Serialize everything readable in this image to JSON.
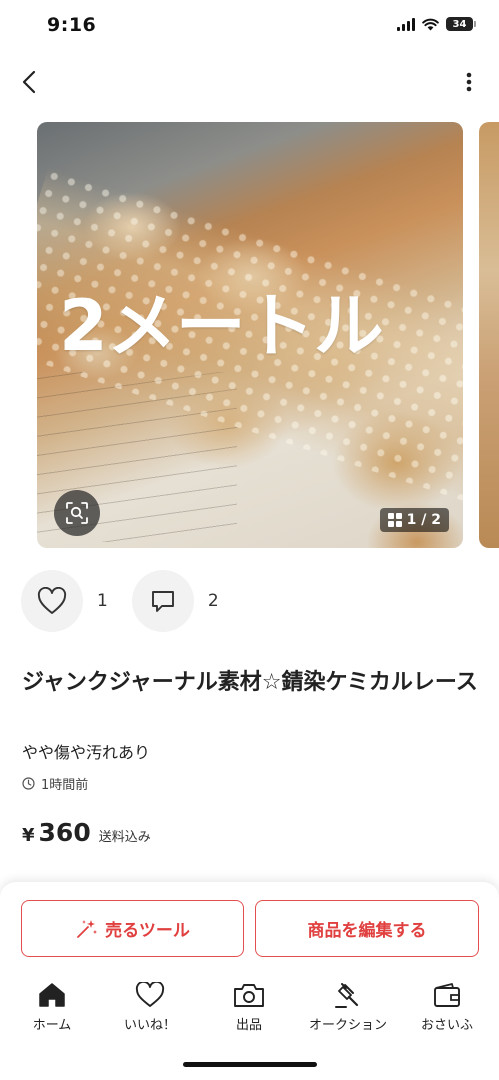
{
  "status_bar": {
    "time": "9:16",
    "battery": "34"
  },
  "gallery": {
    "overlay_text": "2メートル",
    "counter": "1 / 2"
  },
  "reactions": {
    "likes": "1",
    "comments": "2"
  },
  "item": {
    "title": "ジャンクジャーナル素材☆錆染ケミカルレース",
    "condition": "やや傷や汚れあり",
    "posted": "1時間前",
    "price_currency": "¥",
    "price": "360",
    "shipping": "送料込み"
  },
  "actions": {
    "sell_tools": "売るツール",
    "edit_item": "商品を編集する"
  },
  "tabs": [
    {
      "label": "ホーム",
      "icon": "home-icon"
    },
    {
      "label": "いいね！",
      "icon": "heart-icon"
    },
    {
      "label": "出品",
      "icon": "camera-icon"
    },
    {
      "label": "オークション",
      "icon": "gavel-icon"
    },
    {
      "label": "おさいふ",
      "icon": "wallet-icon"
    }
  ],
  "colors": {
    "accent": "#e0403f",
    "text": "#222222",
    "icon_bg": "#f2f2f2"
  }
}
